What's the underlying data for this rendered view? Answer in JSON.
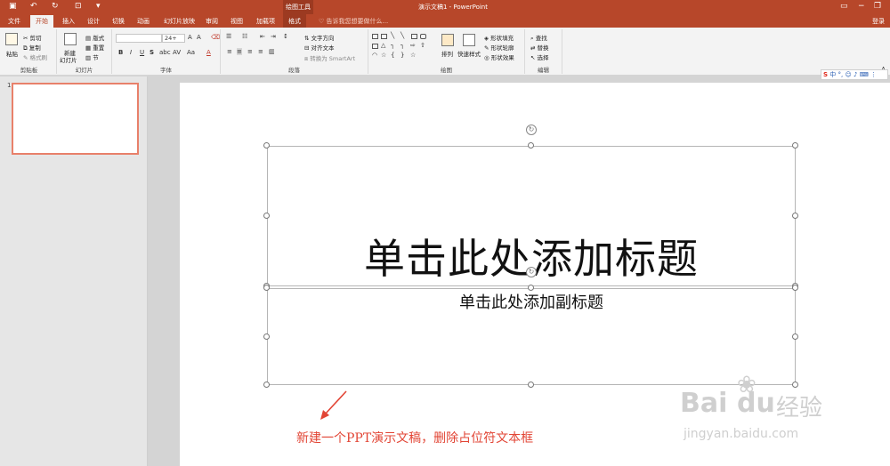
{
  "titlebar": {
    "contextual_tool": "绘图工具",
    "title": "演示文稿1 - PowerPoint"
  },
  "tabs": [
    "文件",
    "开始",
    "插入",
    "设计",
    "切换",
    "动画",
    "幻灯片放映",
    "审阅",
    "视图",
    "加载项",
    "格式"
  ],
  "tell_me": "告诉我您想要做什么...",
  "login": "登录",
  "ribbon": {
    "clipboard": {
      "label": "剪贴板",
      "paste": "粘贴",
      "cut": "剪切",
      "copy": "复制",
      "format_painter": "格式刷"
    },
    "slides": {
      "label": "幻灯片",
      "new_slide": "新建",
      "new_slide2": "幻灯片",
      "layout": "版式",
      "reset": "重置",
      "section": "节"
    },
    "font": {
      "label": "字体",
      "font_name": "",
      "font_size": "24+",
      "aa": "Aa"
    },
    "paragraph": {
      "label": "段落",
      "text_direction": "文字方向",
      "align_text": "对齐文本",
      "smartart": "转换为 SmartArt"
    },
    "drawing": {
      "label": "绘图",
      "arrange": "排列",
      "quick_styles": "快速样式",
      "shape_fill": "形状填充",
      "shape_outline": "形状轮廓",
      "shape_effects": "形状效果"
    },
    "editing": {
      "label": "编辑",
      "find": "查找",
      "replace": "替换",
      "select": "选择"
    }
  },
  "ime": {
    "s": "S",
    "mode": "中"
  },
  "thumbnail": {
    "number": "1"
  },
  "slide": {
    "title_placeholder": "单击此处添加标题",
    "subtitle_placeholder": "单击此处添加副标题"
  },
  "annotation": "新建一个PPT演示文稿，删除占位符文本框",
  "watermark": {
    "brand": "Bai",
    "brand2": "du",
    "cn": "经验",
    "url": "jingyan.baidu.com"
  },
  "colors": {
    "accent": "#b7472a",
    "annotation": "#e24535"
  }
}
